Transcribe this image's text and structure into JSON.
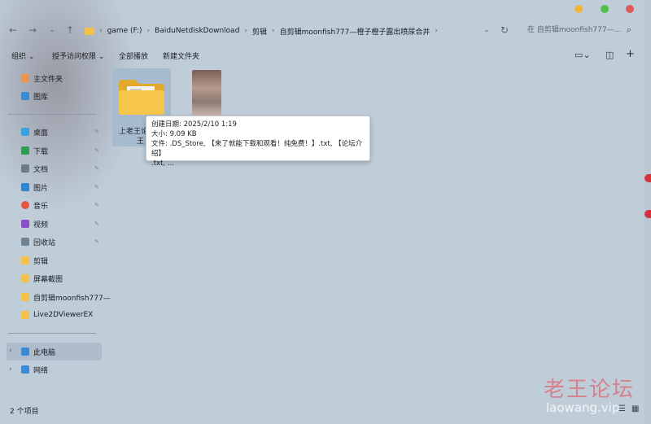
{
  "window": {
    "controls": {
      "minimize_color": "#f2b43b",
      "maximize_color": "#52c14a",
      "close_color": "#e0575c"
    }
  },
  "nav": {
    "back_icon": "arrow-left-icon",
    "forward_icon": "arrow-right-icon",
    "up_icon": "arrow-up-icon",
    "refresh_icon": "refresh-icon"
  },
  "breadcrumb": [
    {
      "label": "game (F:)"
    },
    {
      "label": "BaiduNetdiskDownload"
    },
    {
      "label": "剪辑"
    },
    {
      "label": "自剪辑moonfish777—橙子橙子露出喷尿合并"
    }
  ],
  "search": {
    "placeholder": "在 自剪辑moonfish777—..."
  },
  "toolbar": {
    "organize": "组织 ⌄",
    "access": "授予访问权限 ⌄",
    "play_all": "全部播放",
    "new_folder": "新建文件夹"
  },
  "sidebar": {
    "top": [
      {
        "label": "主文件夹",
        "icon": "home-icon",
        "color": "#e9944a"
      },
      {
        "label": "图库",
        "icon": "gallery-icon",
        "color": "#3a8ad6"
      }
    ],
    "quick": [
      {
        "label": "桌面",
        "icon": "desktop-icon",
        "color": "#3aa1e0"
      },
      {
        "label": "下载",
        "icon": "download-icon",
        "color": "#2f9e55"
      },
      {
        "label": "文档",
        "icon": "document-icon",
        "color": "#6b7c8c"
      },
      {
        "label": "图片",
        "icon": "pictures-icon",
        "color": "#2f86d1"
      },
      {
        "label": "音乐",
        "icon": "music-icon",
        "color": "#e2573b"
      },
      {
        "label": "视频",
        "icon": "video-icon",
        "color": "#8a4fc8"
      },
      {
        "label": "回收站",
        "icon": "recycle-bin-icon",
        "color": "#6f8294"
      },
      {
        "label": "剪辑",
        "icon": "folder-icon",
        "color": "#f2c14a"
      },
      {
        "label": "屏幕截图",
        "icon": "folder-icon",
        "color": "#f2c14a"
      },
      {
        "label": "自剪辑moonfish777—",
        "icon": "folder-icon",
        "color": "#f2c14a"
      },
      {
        "label": "Live2DViewerEX",
        "icon": "folder-icon",
        "color": "#f2c14a"
      }
    ],
    "devices": [
      {
        "label": "此电脑",
        "icon": "computer-icon",
        "color": "#3a8ad6"
      },
      {
        "label": "网络",
        "icon": "network-icon",
        "color": "#3a8ad6"
      }
    ]
  },
  "files": [
    {
      "label": "上老王论",
      "label2": "王",
      "type": "folder"
    },
    {
      "label": "",
      "type": "video"
    }
  ],
  "tooltip": {
    "line1": "创建日期: 2025/2/10 1:19",
    "line2": "大小: 9.09 KB",
    "line3": "文件: .DS_Store, 【来了就能下载和观看！纯免费！】.txt, 【论坛介绍】",
    "line4": ".txt, ..."
  },
  "status": {
    "count": "2 个项目"
  },
  "watermark": {
    "cn": "老王论坛",
    "en": "laowang.vip"
  }
}
